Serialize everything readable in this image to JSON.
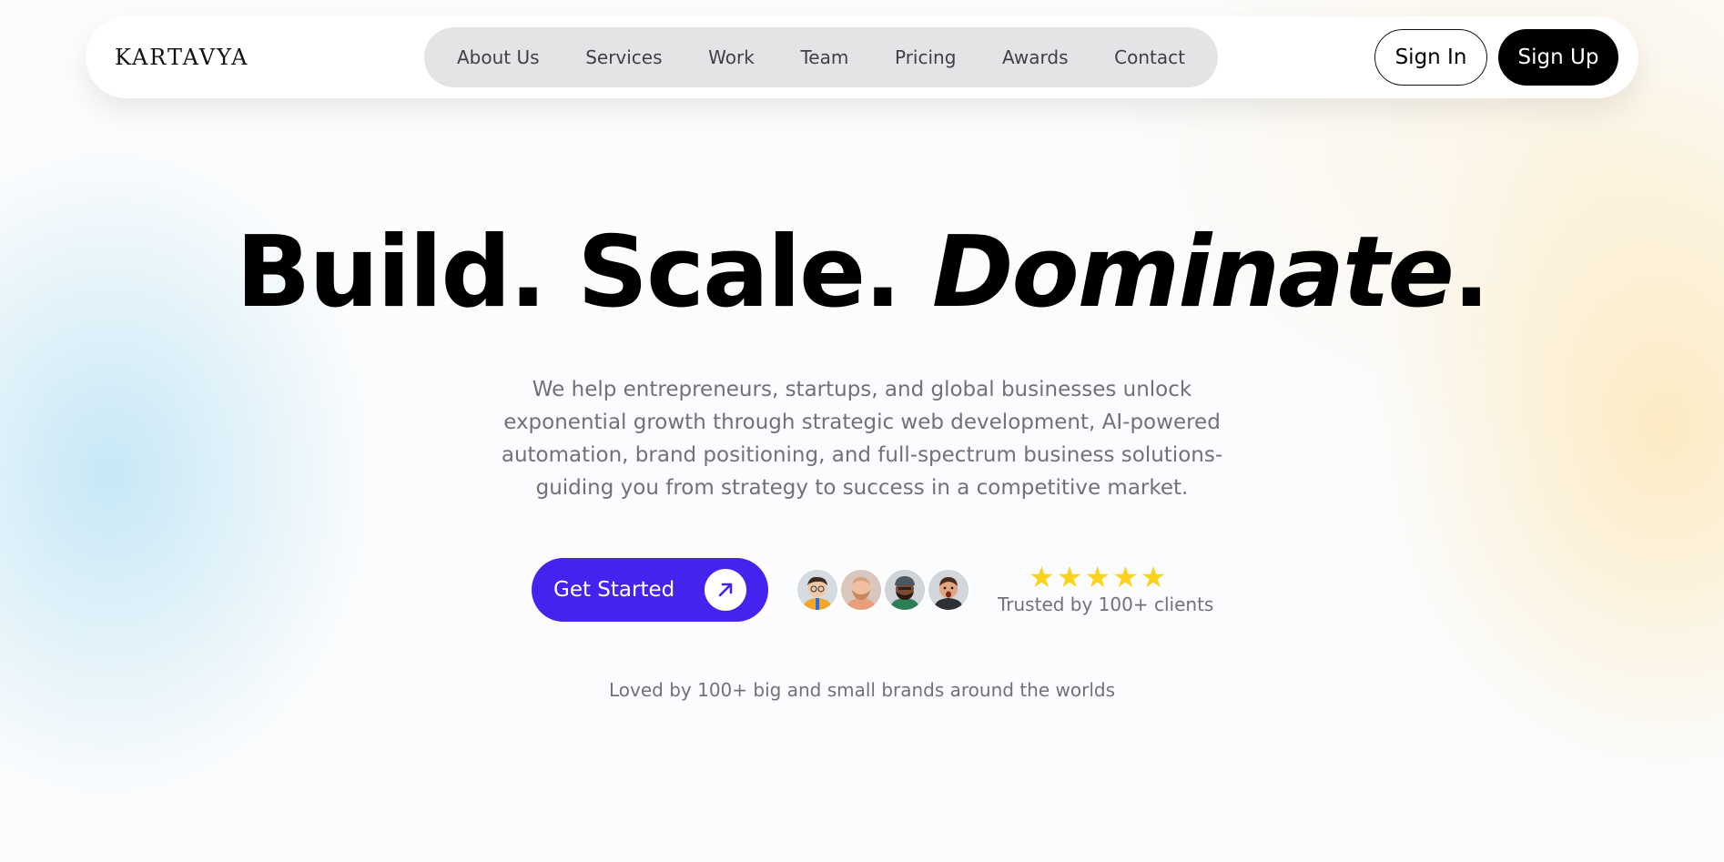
{
  "header": {
    "logo": "KARTAVYA",
    "nav": [
      "About Us",
      "Services",
      "Work",
      "Team",
      "Pricing",
      "Awards",
      "Contact"
    ],
    "sign_in": "Sign In",
    "sign_up": "Sign Up"
  },
  "hero": {
    "title_plain": "Build. Scale.",
    "title_italic": "Dominate",
    "title_period": ".",
    "subtitle": "We help entrepreneurs, startups, and global businesses unlock exponential growth through strategic web development, AI-powered automation, brand positioning, and full-spectrum business solutions- guiding you from strategy to success in a competitive market.",
    "cta_label": "Get Started",
    "cta_icon": "arrow-up-right-icon",
    "avatars": [
      "avatar-man-glasses",
      "avatar-man-beard",
      "avatar-man-hat",
      "avatar-man-shocked"
    ],
    "rating": 5,
    "trusted_text": "Trusted by 100+ clients",
    "loved_text": "Loved by 100+ big and small brands around the worlds"
  },
  "colors": {
    "accent": "#4324ef",
    "star": "#fcd21d",
    "muted_text": "#71717a",
    "nav_pill": "#e4e4e7"
  }
}
